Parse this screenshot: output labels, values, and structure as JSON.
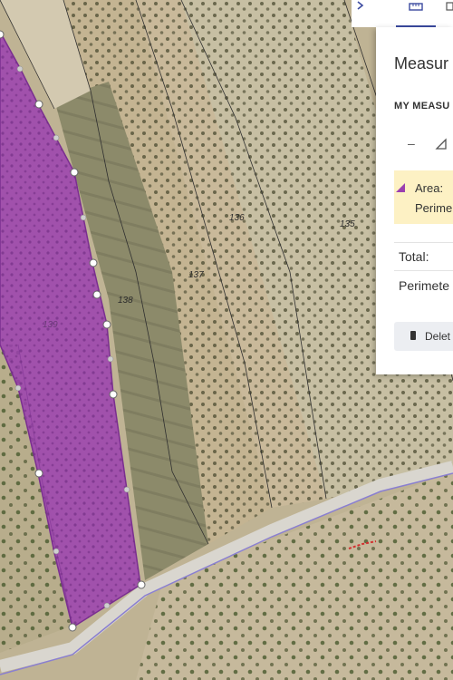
{
  "map": {
    "parcels": [
      "139",
      "138",
      "137",
      "136",
      "135"
    ],
    "measured_color": "#9b3fb0"
  },
  "panel": {
    "title": "Measur",
    "section_label": "MY MEASU",
    "area_label": "Area:",
    "perimeter_short": "Perime",
    "total_label": "Total:",
    "perimeter_label": "Perimete",
    "delete_label": "Delet",
    "tools": [
      "minus-tool-icon",
      "triangle-tool-icon"
    ]
  }
}
